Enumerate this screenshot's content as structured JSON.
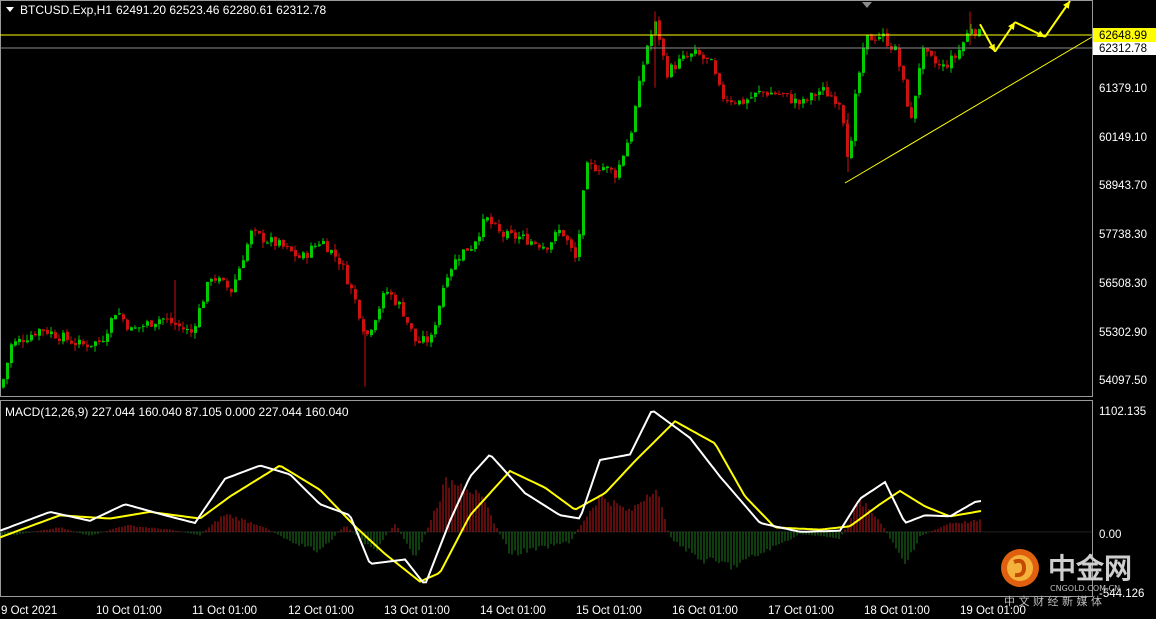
{
  "header": {
    "symbol": "BTCUSD.Exp,H1",
    "ohlc": "62491.20 62523.46 62280.61 62312.78"
  },
  "macd_header": "MACD(12,26,9) 227.044 160.040 87.105 0.000 227.044 160.040",
  "price_axis": [
    "61379.10",
    "60149.10",
    "58943.70",
    "57738.30",
    "56508.30",
    "55302.90",
    "54097.50"
  ],
  "price_labels": {
    "resistance": "62648.99",
    "current": "62312.78"
  },
  "macd_axis": [
    "1102.135",
    "0.00",
    "-544.126"
  ],
  "time_axis": [
    "9 Oct 2021",
    "10 Oct 01:00",
    "11 Oct 01:00",
    "12 Oct 01:00",
    "13 Oct 01:00",
    "14 Oct 01:00",
    "15 Oct 01:00",
    "16 Oct 01:00",
    "17 Oct 01:00",
    "18 Oct 01:00",
    "19 Oct 01:00"
  ],
  "watermark": {
    "brand": "中金网",
    "site": "CNGOLD.COM.CN",
    "tagline": "中 文 财 经 新 媒 体"
  },
  "colors": {
    "bull": "#00cc00",
    "bear": "#cc1111",
    "macd_line": "#ffffff",
    "signal_line": "#ffff00",
    "resistance": "#ffff00",
    "trendline": "#ffff00",
    "projection": "#ffff00",
    "grid_line": "#808080"
  },
  "chart_data": {
    "type": "candlestick",
    "timeframe": "H1",
    "price_range": [
      53800,
      63150
    ],
    "resistance_level": 62648.99,
    "current_price": 62312.78,
    "trendline": {
      "from": [
        "17 Oct",
        58943.7
      ],
      "to": [
        "19 Oct",
        62600
      ]
    },
    "close_path": [
      [
        0,
        54000
      ],
      [
        10,
        55000
      ],
      [
        40,
        55400
      ],
      [
        80,
        55000
      ],
      [
        100,
        55100
      ],
      [
        115,
        55850
      ],
      [
        130,
        55350
      ],
      [
        160,
        55650
      ],
      [
        190,
        55300
      ],
      [
        210,
        56650
      ],
      [
        230,
        56300
      ],
      [
        250,
        57650
      ],
      [
        280,
        57350
      ],
      [
        300,
        57050
      ],
      [
        320,
        57500
      ],
      [
        340,
        56950
      ],
      [
        355,
        56000
      ],
      [
        365,
        55200
      ],
      [
        385,
        56300
      ],
      [
        400,
        55900
      ],
      [
        415,
        55050
      ],
      [
        430,
        55150
      ],
      [
        445,
        56700
      ],
      [
        460,
        57200
      ],
      [
        470,
        57350
      ],
      [
        485,
        58000
      ],
      [
        500,
        57600
      ],
      [
        520,
        57550
      ],
      [
        545,
        57350
      ],
      [
        560,
        57750
      ],
      [
        575,
        57000
      ],
      [
        585,
        59200
      ],
      [
        600,
        59250
      ],
      [
        615,
        59050
      ],
      [
        630,
        60100
      ],
      [
        645,
        62050
      ],
      [
        655,
        62650
      ],
      [
        665,
        61450
      ],
      [
        680,
        61750
      ],
      [
        695,
        61900
      ],
      [
        710,
        61650
      ],
      [
        720,
        60900
      ],
      [
        740,
        60750
      ],
      [
        760,
        61000
      ],
      [
        780,
        60950
      ],
      [
        800,
        60700
      ],
      [
        820,
        61050
      ],
      [
        840,
        60750
      ],
      [
        848,
        59200
      ],
      [
        855,
        61100
      ],
      [
        865,
        62250
      ],
      [
        880,
        62350
      ],
      [
        895,
        61950
      ],
      [
        910,
        60300
      ],
      [
        920,
        61950
      ],
      [
        940,
        61550
      ],
      [
        955,
        61850
      ],
      [
        970,
        62550
      ],
      [
        980,
        62312
      ]
    ],
    "projection": [
      [
        980,
        62600
      ],
      [
        995,
        61950
      ],
      [
        1015,
        62650
      ],
      [
        1045,
        62300
      ],
      [
        1070,
        63150
      ]
    ],
    "macd": {
      "params": [
        12,
        26,
        9
      ],
      "values": [
        227.044,
        160.04,
        87.105,
        0.0
      ],
      "range": [
        -544.126,
        1102.135
      ],
      "main": [
        [
          0,
          10
        ],
        [
          50,
          180
        ],
        [
          90,
          100
        ],
        [
          125,
          250
        ],
        [
          165,
          150
        ],
        [
          195,
          80
        ],
        [
          225,
          480
        ],
        [
          260,
          600
        ],
        [
          290,
          520
        ],
        [
          320,
          250
        ],
        [
          350,
          150
        ],
        [
          370,
          -290
        ],
        [
          405,
          -250
        ],
        [
          425,
          -480
        ],
        [
          450,
          100
        ],
        [
          470,
          500
        ],
        [
          490,
          700
        ],
        [
          525,
          350
        ],
        [
          560,
          150
        ],
        [
          580,
          120
        ],
        [
          600,
          650
        ],
        [
          630,
          700
        ],
        [
          652,
          1102
        ],
        [
          690,
          850
        ],
        [
          720,
          500
        ],
        [
          760,
          80
        ],
        [
          800,
          0
        ],
        [
          840,
          10
        ],
        [
          860,
          300
        ],
        [
          885,
          450
        ],
        [
          905,
          80
        ],
        [
          925,
          150
        ],
        [
          950,
          140
        ],
        [
          975,
          270
        ],
        [
          982,
          280
        ]
      ],
      "signal": [
        [
          0,
          -50
        ],
        [
          60,
          150
        ],
        [
          110,
          120
        ],
        [
          150,
          180
        ],
        [
          200,
          120
        ],
        [
          230,
          320
        ],
        [
          280,
          600
        ],
        [
          320,
          380
        ],
        [
          355,
          50
        ],
        [
          385,
          -200
        ],
        [
          420,
          -450
        ],
        [
          440,
          -370
        ],
        [
          470,
          150
        ],
        [
          510,
          550
        ],
        [
          545,
          400
        ],
        [
          575,
          200
        ],
        [
          605,
          350
        ],
        [
          635,
          640
        ],
        [
          675,
          1000
        ],
        [
          715,
          800
        ],
        [
          745,
          320
        ],
        [
          775,
          40
        ],
        [
          820,
          20
        ],
        [
          850,
          50
        ],
        [
          880,
          250
        ],
        [
          900,
          370
        ],
        [
          925,
          230
        ],
        [
          950,
          140
        ],
        [
          982,
          190
        ]
      ],
      "histogram": [
        [
          0,
          -50
        ],
        [
          60,
          40
        ],
        [
          90,
          -40
        ],
        [
          125,
          60
        ],
        [
          170,
          20
        ],
        [
          200,
          -30
        ],
        [
          225,
          160
        ],
        [
          260,
          60
        ],
        [
          290,
          -80
        ],
        [
          320,
          -180
        ],
        [
          345,
          60
        ],
        [
          375,
          -180
        ],
        [
          395,
          80
        ],
        [
          415,
          -250
        ],
        [
          445,
          430
        ],
        [
          460,
          490
        ],
        [
          485,
          250
        ],
        [
          510,
          -200
        ],
        [
          545,
          -140
        ],
        [
          570,
          -90
        ],
        [
          600,
          330
        ],
        [
          630,
          180
        ],
        [
          655,
          420
        ],
        [
          670,
          -50
        ],
        [
          700,
          -250
        ],
        [
          735,
          -310
        ],
        [
          760,
          -200
        ],
        [
          800,
          -20
        ],
        [
          840,
          -60
        ],
        [
          860,
          280
        ],
        [
          880,
          100
        ],
        [
          905,
          -300
        ],
        [
          920,
          -40
        ],
        [
          950,
          80
        ],
        [
          982,
          100
        ]
      ]
    }
  }
}
